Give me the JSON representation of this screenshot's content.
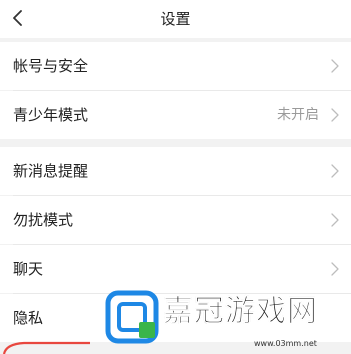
{
  "header": {
    "title": "设置"
  },
  "items": [
    {
      "label": "帐号与安全",
      "value": ""
    },
    {
      "label": "青少年模式",
      "value": "未开启"
    },
    {
      "label": "新消息提醒",
      "value": ""
    },
    {
      "label": "勿扰模式",
      "value": ""
    },
    {
      "label": "聊天",
      "value": ""
    },
    {
      "label": "隐私",
      "value": ""
    }
  ],
  "watermark": {
    "text": "嘉冠游戏网",
    "url": "www.03mm.net"
  },
  "colors": {
    "background": "#f2f2f2",
    "row_background": "#ffffff",
    "secondary_text": "#9a9a9a",
    "logo_blue": "#1e88e5",
    "logo_green": "#3ab54a"
  }
}
